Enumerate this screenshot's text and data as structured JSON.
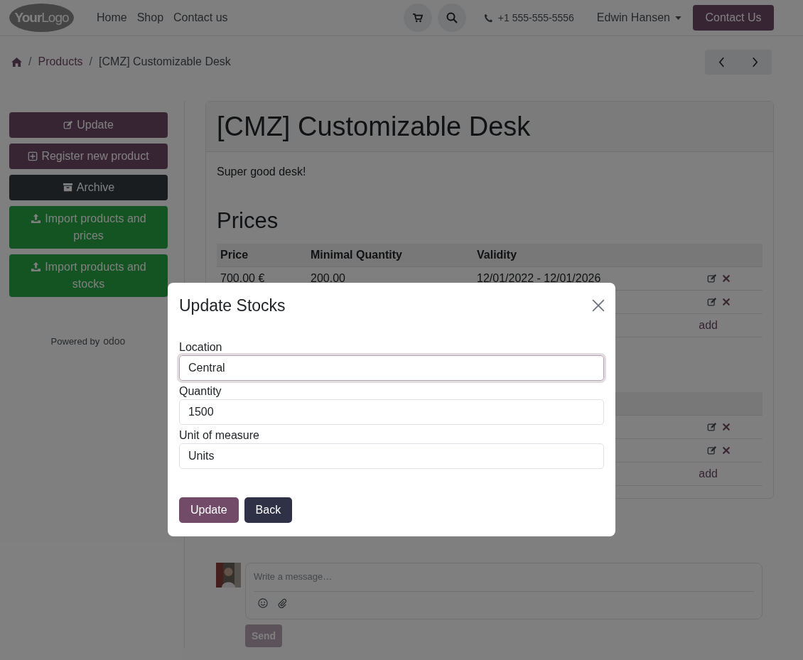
{
  "navbar": {
    "logo": "**Your**Logo",
    "links": [
      "Home",
      "Shop",
      "Contact us"
    ],
    "phone": "+1 555-555-5556",
    "user": "Edwin Hansen",
    "cta": "Contact Us"
  },
  "breadcrumb": [
    {
      "separator": "/",
      "label": "Products"
    },
    {
      "separator": "/",
      "label": "[CMZ] Customizable Desk"
    }
  ],
  "sidebar": {
    "buttons": [
      {
        "label": "Update",
        "kind": "primary"
      },
      {
        "label": "Register new product",
        "kind": "primary"
      },
      {
        "label": "Archive",
        "kind": "dark"
      },
      {
        "label": "Import products and prices",
        "kind": "success"
      },
      {
        "label": "Import products and stocks",
        "kind": "success"
      }
    ],
    "powered_by": "Powered by",
    "brand": "odoo"
  },
  "product": {
    "title": "[CMZ] Customizable Desk",
    "description": "Super good desk!",
    "prices_heading": "Prices",
    "prices_table": {
      "columns": [
        "Price",
        "Minimal Quantity",
        "Validity"
      ],
      "rows": [
        {
          "kind": "entry",
          "cells": [
            "700.00 €",
            "200.00",
            "12/01/2022 - 12/01/2026"
          ]
        },
        {
          "kind": "entry"
        },
        {
          "kind": "add",
          "text": "add"
        }
      ]
    },
    "stock_table": {
      "rows": [
        {
          "kind": "entry"
        },
        {
          "kind": "entry"
        },
        {
          "kind": "add",
          "text": "add"
        }
      ]
    }
  },
  "communication": {
    "placeholder": "Write a message…",
    "send": "Send",
    "send_disabled": true
  },
  "modal": {
    "title": "Update Stocks",
    "fields": [
      {
        "label": "Location",
        "value": "Central",
        "focused": true
      },
      {
        "label": "Quantity",
        "value": "1500",
        "focused": false
      },
      {
        "label": "Unit of measure",
        "value": "Units",
        "focused": false
      }
    ],
    "buttons": [
      {
        "label": "Update",
        "kind": "primary"
      },
      {
        "label": "Back",
        "kind": "dark"
      }
    ]
  }
}
